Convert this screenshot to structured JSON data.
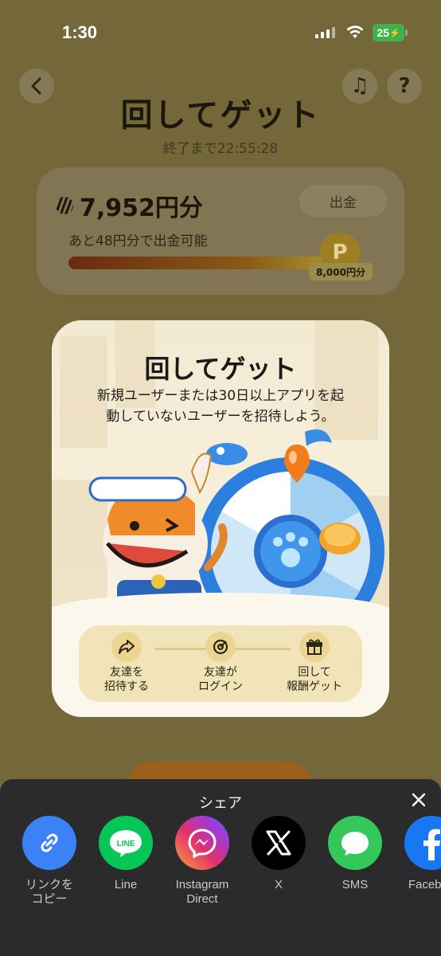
{
  "status_bar": {
    "time": "1:30",
    "battery": "25"
  },
  "background": {
    "title": "回してゲット",
    "countdown": "終了まで22:55:28",
    "balance": "7,952円分",
    "withdraw_label": "出金",
    "remaining_text": "あと48円分で出金可能",
    "target_badge": "8,000円分",
    "progress_fraction": 0.994,
    "coin_letter": "P"
  },
  "modal": {
    "title": "回してゲット",
    "description_line1": "新規ユーザーまたは30日以上アプリを起",
    "description_line2": "動していないユーザーを招待しよう。",
    "steps": [
      {
        "line1": "友達を",
        "line2": "招待する",
        "icon": "share-arrow-icon"
      },
      {
        "line1": "友達が",
        "line2": "ログイン",
        "icon": "target-icon"
      },
      {
        "line1": "回して",
        "line2": "報酬ゲット",
        "icon": "gift-icon"
      }
    ]
  },
  "share_sheet": {
    "title": "シェア",
    "items": [
      {
        "line1": "リンクを",
        "line2": "コピー",
        "icon": "link-icon",
        "color": "#3b82f6"
      },
      {
        "line1": "Line",
        "line2": "",
        "icon": "line-icon",
        "color": "#06c755"
      },
      {
        "line1": "Instagram",
        "line2": "Direct",
        "icon": "messenger-icon",
        "color": "#d13fb0"
      },
      {
        "line1": "X",
        "line2": "",
        "icon": "x-icon",
        "color": "#000000"
      },
      {
        "line1": "SMS",
        "line2": "",
        "icon": "sms-icon",
        "color": "#34c759"
      },
      {
        "line1": "Faceboo",
        "line2": "",
        "icon": "facebook-icon",
        "color": "#1877f2"
      }
    ]
  }
}
